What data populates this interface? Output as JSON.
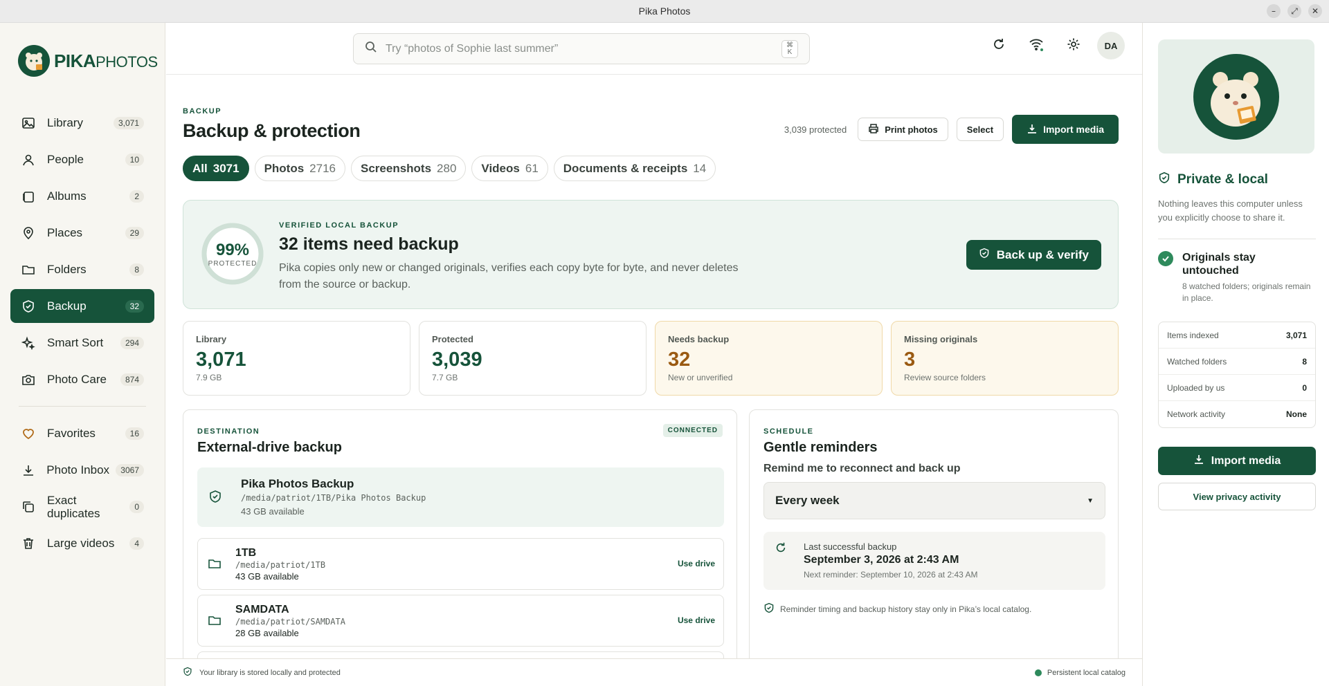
{
  "window": {
    "title": "Pika Photos"
  },
  "brand": {
    "name_bold": "PIKA",
    "name_light": "PHOTOS"
  },
  "sidebar": {
    "items": [
      {
        "label": "Library",
        "count": "3,071",
        "icon": "image-icon"
      },
      {
        "label": "People",
        "count": "10",
        "icon": "person-icon"
      },
      {
        "label": "Albums",
        "count": "2",
        "icon": "album-icon"
      },
      {
        "label": "Places",
        "count": "29",
        "icon": "map-pin-icon"
      },
      {
        "label": "Folders",
        "count": "8",
        "icon": "folder-icon"
      },
      {
        "label": "Backup",
        "count": "32",
        "icon": "shield-check-icon",
        "active": true
      },
      {
        "label": "Smart Sort",
        "count": "294",
        "icon": "sparkle-icon"
      },
      {
        "label": "Photo Care",
        "count": "874",
        "icon": "camera-icon"
      }
    ],
    "items2": [
      {
        "label": "Favorites",
        "count": "16",
        "icon": "heart-icon"
      },
      {
        "label": "Photo Inbox",
        "count": "3067",
        "icon": "download-icon"
      },
      {
        "label": "Exact duplicates",
        "count": "0",
        "icon": "duplicate-icon"
      },
      {
        "label": "Large videos",
        "count": "4",
        "icon": "trash-icon"
      }
    ]
  },
  "search": {
    "placeholder": "Try “photos of Sophie last summer”",
    "shortcut_top": "⌘",
    "shortcut_bottom": "K"
  },
  "user": {
    "initials": "DA"
  },
  "page": {
    "eyebrow": "BACKUP",
    "title": "Backup & protection",
    "protected_count": "3,039 protected",
    "print_label": "Print photos",
    "select_label": "Select",
    "import_label": "Import media"
  },
  "tabs": [
    {
      "label": "All",
      "count": "3071",
      "active": true
    },
    {
      "label": "Photos",
      "count": "2716"
    },
    {
      "label": "Screenshots",
      "count": "280"
    },
    {
      "label": "Videos",
      "count": "61"
    },
    {
      "label": "Documents & receipts",
      "count": "14"
    }
  ],
  "hero": {
    "percent_value": 0.99,
    "percent_text": "99%",
    "percent_label": "PROTECTED",
    "eyebrow": "VERIFIED LOCAL BACKUP",
    "title": "32 items need backup",
    "desc": "Pika copies only new or changed originals, verifies each copy byte for byte, and never deletes from the source or backup.",
    "button": "Back up & verify"
  },
  "stats": [
    {
      "label": "Library",
      "value": "3,071",
      "sub": "7.9 GB"
    },
    {
      "label": "Protected",
      "value": "3,039",
      "sub": "7.7 GB"
    },
    {
      "label": "Needs backup",
      "value": "32",
      "sub": "New or unverified"
    },
    {
      "label": "Missing originals",
      "value": "3",
      "sub": "Review source folders"
    }
  ],
  "destination": {
    "eyebrow": "DESTINATION",
    "title": "External-drive backup",
    "status": "CONNECTED",
    "current": {
      "name": "Pika Photos Backup",
      "path": "/media/patriot/1TB/Pika Photos Backup",
      "available": "43 GB available"
    },
    "drives": [
      {
        "name": "1TB",
        "path": "/media/patriot/1TB",
        "available": "43 GB available",
        "action": "Use drive"
      },
      {
        "name": "SAMDATA",
        "path": "/media/patriot/SAMDATA",
        "available": "28 GB available",
        "action": "Use drive"
      }
    ]
  },
  "schedule": {
    "eyebrow": "SCHEDULE",
    "title": "Gentle reminders",
    "question": "Remind me to reconnect and back up",
    "selected": "Every week",
    "last_label": "Last successful backup",
    "last_date": "September 3, 2026 at 2:43 AM",
    "next": "Next reminder: September 10, 2026 at 2:43 AM",
    "note": "Reminder timing and backup history stay only in Pika’s local catalog."
  },
  "privacy": {
    "title": "Private & local",
    "desc": "Nothing leaves this computer unless you explicitly choose to share it.",
    "orig_title": "Originals stay untouched",
    "orig_sub": "8 watched folders; originals remain in place.",
    "rows": [
      {
        "k": "Items indexed",
        "v": "3,071"
      },
      {
        "k": "Watched folders",
        "v": "8"
      },
      {
        "k": "Uploaded by us",
        "v": "0"
      },
      {
        "k": "Network activity",
        "v": "None"
      }
    ],
    "import_label": "Import media",
    "view_label": "View privacy activity"
  },
  "statusbar": {
    "left": "Your library is stored locally and protected",
    "right": "Persistent local catalog"
  },
  "colors": {
    "brand": "#16533a",
    "warn": "#9a5a12",
    "warn_bg": "#fdf8ec"
  }
}
